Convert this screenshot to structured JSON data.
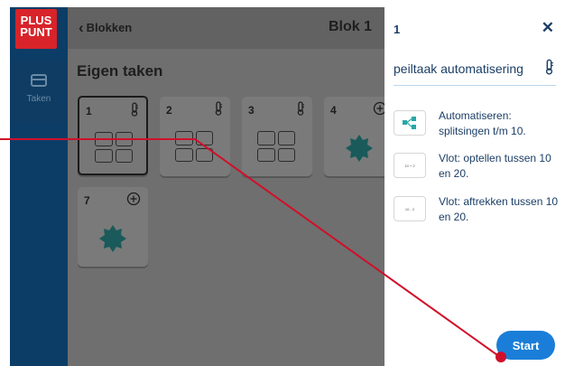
{
  "app": {
    "logo_line1": "PLUS",
    "logo_line2": "PUNT"
  },
  "rail": {
    "items": [
      {
        "label": "Taken",
        "icon": "window-icon"
      }
    ]
  },
  "header": {
    "back_label": "Blokken",
    "title": "Blok 1"
  },
  "main": {
    "section_title": "Eigen taken",
    "cards": [
      {
        "number": "1",
        "icon": "thermometer-icon",
        "content": "grid-icon",
        "selected": true
      },
      {
        "number": "2",
        "icon": "thermometer-icon",
        "content": "grid-icon",
        "selected": false
      },
      {
        "number": "3",
        "icon": "thermometer-icon",
        "content": "grid-icon",
        "selected": false
      },
      {
        "number": "4",
        "icon": "plus-circle-icon",
        "content": "puzzle-icon",
        "selected": false
      },
      {
        "number": "7",
        "icon": "plus-circle-icon",
        "content": "puzzle-icon",
        "selected": false
      }
    ]
  },
  "panel": {
    "number": "1",
    "close_icon": "close-icon",
    "task_name": "peiltaak automatisering",
    "items": [
      {
        "label": "Automatiseren: splitsingen t/m 10.",
        "thumb": "hierarchy-icon"
      },
      {
        "label": "Vlot: optellen tussen 10 en 20.",
        "thumb": "10 + 2"
      },
      {
        "label": "Vlot: aftrekken tussen 10 en 20.",
        "thumb": "10 - 2"
      }
    ],
    "start_label": "Start"
  },
  "colors": {
    "rail": "#0c3d66",
    "accent": "#1a7ed8",
    "brand_red": "#d8232a",
    "annotation": "#d0102a"
  }
}
